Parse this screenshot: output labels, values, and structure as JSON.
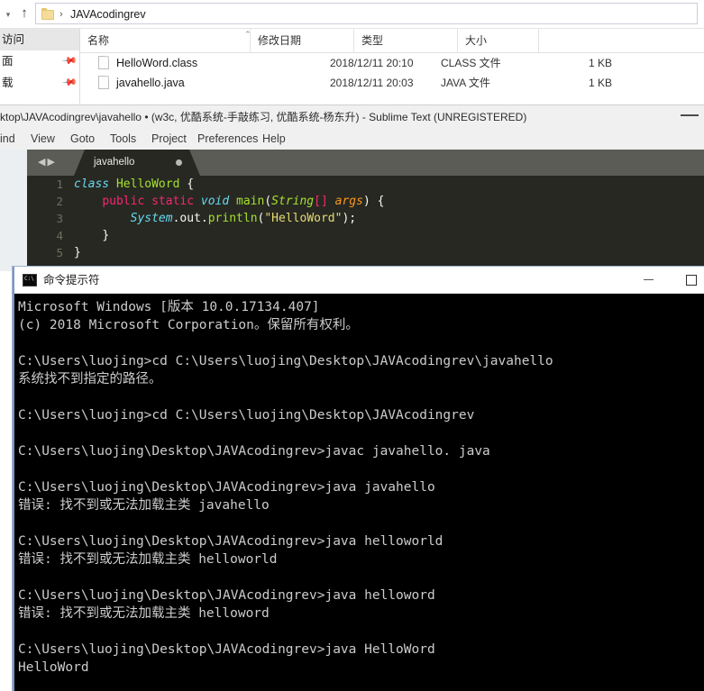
{
  "explorer": {
    "address": {
      "back_chevron_icon": "chevron-down-icon",
      "up_icon": "▲",
      "folder_icon": "folder-icon",
      "separator": "›",
      "path": "JAVAcodingrev"
    },
    "nav_pane": {
      "items": [
        {
          "label": "访问",
          "pinned": false,
          "selected": true
        },
        {
          "label": "面",
          "pinned": true,
          "selected": false
        },
        {
          "label": "载",
          "pinned": true,
          "selected": false
        }
      ],
      "pin_icon": "pin-icon"
    },
    "columns": [
      {
        "label": "名称",
        "key": "name"
      },
      {
        "label": "修改日期",
        "key": "date"
      },
      {
        "label": "类型",
        "key": "type"
      },
      {
        "label": "大小",
        "key": "size"
      }
    ],
    "sort_indicator": "⌃",
    "files": [
      {
        "name": "HelloWord.class",
        "date": "2018/12/11 20:10",
        "type": "CLASS 文件",
        "size": "1 KB",
        "icon": "file-icon"
      },
      {
        "name": "javahello.java",
        "date": "2018/12/11 20:03",
        "type": "JAVA 文件",
        "size": "1 KB",
        "icon": "file-icon"
      }
    ]
  },
  "sublime": {
    "title": "ktop\\JAVAcodingrev\\javahello • (w3c, 优酷系统-手敲练习, 优酷系统-杨东升) - Sublime Text (UNREGISTERED)",
    "minimize_label": "—",
    "menu": [
      {
        "label": "ind"
      },
      {
        "label": "View"
      },
      {
        "label": "Goto"
      },
      {
        "label": "Tools"
      },
      {
        "label": "Project"
      },
      {
        "label": "Preferences"
      },
      {
        "label": "Help"
      }
    ],
    "tab": {
      "label": "javahello",
      "nav_arrows": "◀▶",
      "dirty_dot": "●"
    },
    "code": {
      "line_numbers": [
        "1",
        "2",
        "3",
        "4",
        "5"
      ],
      "lines": [
        "class HelloWord {",
        "    public static void main(String[] args) {",
        "        System.out.println(\"HelloWord\");",
        "    }",
        "}"
      ]
    },
    "colors": {
      "background": "#272822",
      "keyword": "#66d9ef",
      "type": "#a6e22e",
      "modifier": "#f92672",
      "string": "#e6db74",
      "variable": "#fd971f",
      "plain": "#f8f8f2",
      "gutter": "#6f705f",
      "tabbar": "#5b5c56"
    }
  },
  "cmd": {
    "title": "命令提示符",
    "icon": "console-icon",
    "minimize_label": "—",
    "maximize_label": "□",
    "lines": [
      "Microsoft Windows [版本 10.0.17134.407]",
      "(c) 2018 Microsoft Corporation。保留所有权利。",
      "",
      "C:\\Users\\luojing>cd C:\\Users\\luojing\\Desktop\\JAVAcodingrev\\javahello",
      "系统找不到指定的路径。",
      "",
      "C:\\Users\\luojing>cd C:\\Users\\luojing\\Desktop\\JAVAcodingrev",
      "",
      "C:\\Users\\luojing\\Desktop\\JAVAcodingrev>javac javahello. java",
      "",
      "C:\\Users\\luojing\\Desktop\\JAVAcodingrev>java javahello",
      "错误: 找不到或无法加载主类 javahello",
      "",
      "C:\\Users\\luojing\\Desktop\\JAVAcodingrev>java helloworld",
      "错误: 找不到或无法加载主类 helloworld",
      "",
      "C:\\Users\\luojing\\Desktop\\JAVAcodingrev>java helloword",
      "错误: 找不到或无法加载主类 helloword",
      "",
      "C:\\Users\\luojing\\Desktop\\JAVAcodingrev>java HelloWord",
      "HelloWord"
    ],
    "colors": {
      "background": "#000000",
      "foreground": "#cccccc",
      "frame": "#7d98c4"
    }
  }
}
